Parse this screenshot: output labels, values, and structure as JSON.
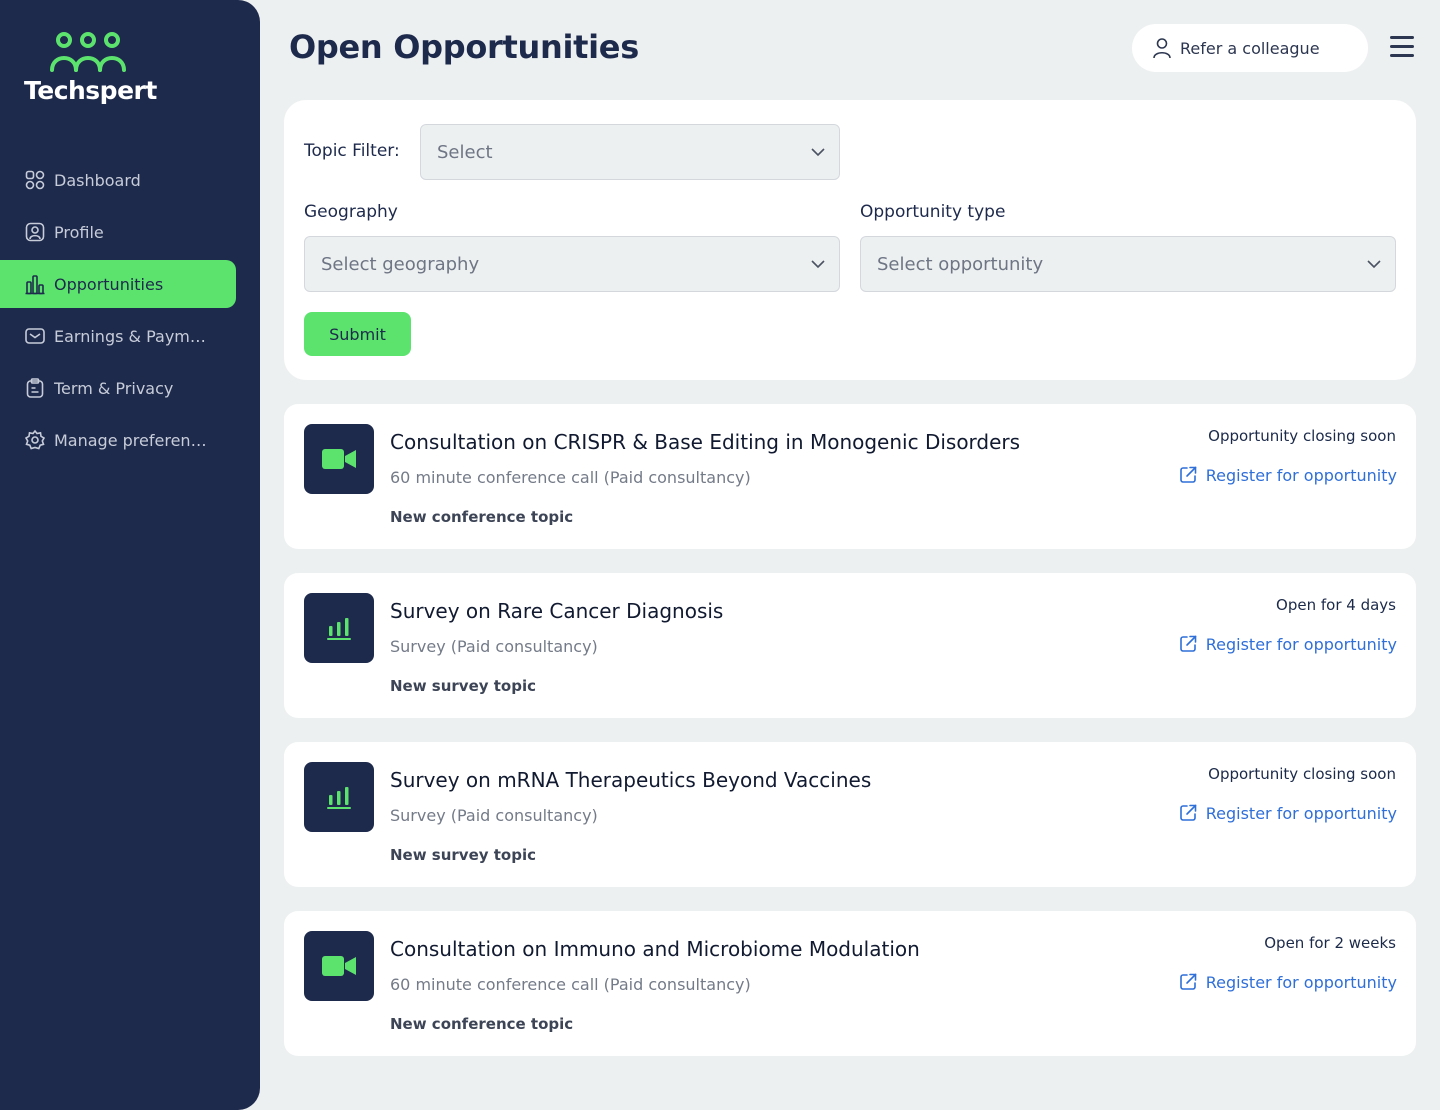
{
  "brand": {
    "name": "Techspert",
    "accent": "#5ce36e",
    "sidebar_bg": "#1e2a4c",
    "link_color": "#2f6fd8"
  },
  "sidebar": {
    "items": [
      {
        "label": "Dashboard",
        "icon": "grid-icon",
        "active": false
      },
      {
        "label": "Profile",
        "icon": "user-badge-icon",
        "active": false
      },
      {
        "label": "Opportunities",
        "icon": "bar-chart-icon",
        "active": true
      },
      {
        "label": "Earnings & Payments",
        "icon": "mail-icon",
        "active": false
      },
      {
        "label": "Term & Privacy",
        "icon": "clipboard-icon",
        "active": false
      },
      {
        "label": "Manage preferences",
        "icon": "gear-icon",
        "active": false
      }
    ]
  },
  "header": {
    "title": "Open Opportunities",
    "refer_label": "Refer a colleague"
  },
  "filters": {
    "topic": {
      "label": "Topic Filter:",
      "placeholder": "Select"
    },
    "geography": {
      "label": "Geography",
      "placeholder": "Select geography"
    },
    "opportunity_type": {
      "label": "Opportunity type",
      "placeholder": "Select opportunity"
    },
    "submit_label": "Submit"
  },
  "register_label": "Register for opportunity",
  "opportunities": [
    {
      "icon": "video-camera-icon",
      "title": "Consultation on CRISPR & Base Editing in Monogenic Disorders",
      "subtitle": "60 minute conference call (Paid consultancy)",
      "topic": "New conference topic",
      "status": "Opportunity closing soon"
    },
    {
      "icon": "bar-chart-icon",
      "title": "Survey on Rare Cancer Diagnosis",
      "subtitle": "Survey (Paid consultancy)",
      "topic": "New survey topic",
      "status": "Open for 4 days"
    },
    {
      "icon": "bar-chart-icon",
      "title": "Survey on mRNA Therapeutics Beyond Vaccines",
      "subtitle": "Survey (Paid consultancy)",
      "topic": "New survey topic",
      "status": "Opportunity closing soon"
    },
    {
      "icon": "video-camera-icon",
      "title": "Consultation on Immuno and Microbiome Modulation",
      "subtitle": "60 minute conference call (Paid consultancy)",
      "topic": "New conference topic",
      "status": "Open for 2 weeks"
    }
  ]
}
